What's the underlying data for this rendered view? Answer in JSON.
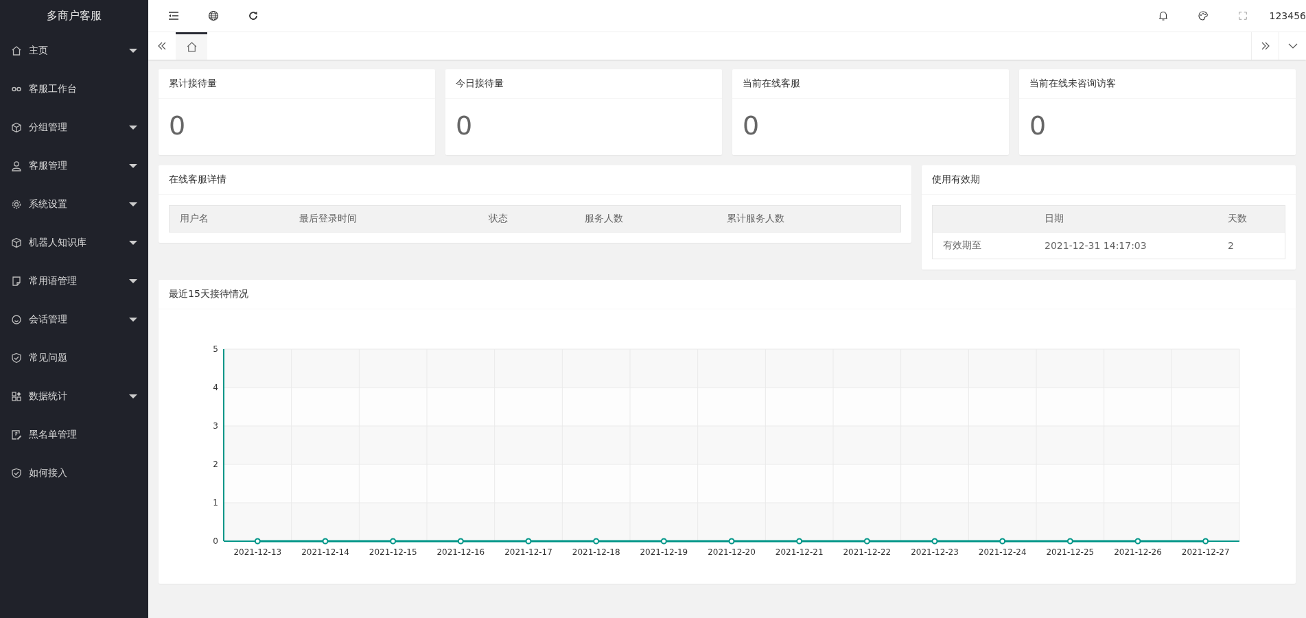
{
  "sidebar": {
    "title": "多商户客服",
    "items": [
      {
        "label": "主页",
        "has_submenu": true
      },
      {
        "label": "客服工作台",
        "has_submenu": false
      },
      {
        "label": "分组管理",
        "has_submenu": true
      },
      {
        "label": "客服管理",
        "has_submenu": true
      },
      {
        "label": "系统设置",
        "has_submenu": true
      },
      {
        "label": "机器人知识库",
        "has_submenu": true
      },
      {
        "label": "常用语管理",
        "has_submenu": true
      },
      {
        "label": "会话管理",
        "has_submenu": true
      },
      {
        "label": "常见问题",
        "has_submenu": false
      },
      {
        "label": "数据统计",
        "has_submenu": true
      },
      {
        "label": "黑名单管理",
        "has_submenu": false
      },
      {
        "label": "如何接入",
        "has_submenu": false
      }
    ]
  },
  "topbar": {
    "user": "123456"
  },
  "tabs": [
    {
      "kind": "home",
      "selected": true
    }
  ],
  "stats": [
    {
      "label": "累计接待量",
      "value": "0"
    },
    {
      "label": "今日接待量",
      "value": "0"
    },
    {
      "label": "当前在线客服",
      "value": "0"
    },
    {
      "label": "当前在线未咨询访客",
      "value": "0"
    }
  ],
  "online_panel": {
    "title": "在线客服详情",
    "columns": [
      "用户名",
      "最后登录时间",
      "状态",
      "服务人数",
      "累计服务人数"
    ]
  },
  "validity_panel": {
    "title": "使用有效期",
    "columns": [
      "",
      "日期",
      "天数"
    ],
    "rows": [
      [
        "有效期至",
        "2021-12-31 14:17:03",
        "2"
      ]
    ]
  },
  "chart_panel": {
    "title": "最近15天接待情况",
    "chart_data": {
      "type": "line",
      "categories": [
        "2021-12-13",
        "2021-12-14",
        "2021-12-15",
        "2021-12-16",
        "2021-12-17",
        "2021-12-18",
        "2021-12-19",
        "2021-12-20",
        "2021-12-21",
        "2021-12-22",
        "2021-12-23",
        "2021-12-24",
        "2021-12-25",
        "2021-12-26",
        "2021-12-27"
      ],
      "ylim": [
        0,
        5
      ],
      "yticks": [
        0,
        1,
        2,
        3,
        4,
        5
      ],
      "grid": true,
      "series": [
        {
          "color": "#009688",
          "marker": true,
          "values": [
            0,
            0,
            0,
            0,
            0,
            0,
            0,
            0,
            0,
            0,
            0,
            0,
            0,
            0,
            0
          ]
        }
      ]
    }
  }
}
